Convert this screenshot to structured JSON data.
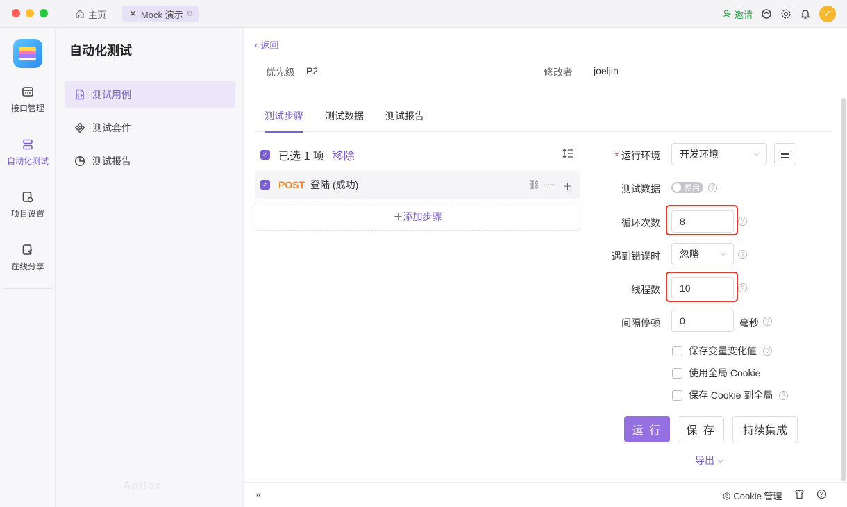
{
  "titlebar": {
    "home_label": "主页",
    "tab_label": "Mock 演示",
    "invite_label": "邀请"
  },
  "rail": {
    "items": [
      {
        "label": "接口管理"
      },
      {
        "label": "自动化测试"
      },
      {
        "label": "项目设置"
      },
      {
        "label": "在线分享"
      }
    ]
  },
  "sidebar": {
    "title": "自动化测试",
    "items": [
      {
        "label": "测试用例"
      },
      {
        "label": "测试套件"
      },
      {
        "label": "测试报告"
      }
    ],
    "watermark": "Apifox"
  },
  "main": {
    "back_label": "返回",
    "priority_label": "优先级",
    "priority_value": "P2",
    "modifier_label": "修改者",
    "modifier_value": "joeljin",
    "tabs": [
      {
        "label": "测试步骤"
      },
      {
        "label": "测试数据"
      },
      {
        "label": "测试报告"
      }
    ],
    "selected_text": "已选 1 项",
    "remove_label": "移除",
    "step": {
      "method": "POST",
      "name": "登陆 (成功)"
    },
    "add_step_label": "＋添加步骤"
  },
  "form": {
    "env_label": "运行环境",
    "env_value": "开发环境",
    "test_data_label": "测试数据",
    "toggle_text": "停用",
    "loop_label": "循环次数",
    "loop_value": "8",
    "on_error_label": "遇到错误时",
    "on_error_value": "忽略",
    "threads_label": "线程数",
    "threads_value": "10",
    "interval_label": "间隔停顿",
    "interval_value": "0",
    "interval_unit": "毫秒",
    "checkboxes": [
      {
        "label": "保存变量变化值",
        "checked": false
      },
      {
        "label": "使用全局 Cookie",
        "checked": false
      },
      {
        "label": "保存 Cookie 到全局",
        "checked": false
      }
    ],
    "run_label": "运 行",
    "save_label": "保 存",
    "ci_label": "持续集成",
    "export_label": "导出"
  },
  "footer": {
    "cookie_label": "Cookie 管理"
  },
  "colors": {
    "accent": "#7b5fd6",
    "primary_button": "#9470e0",
    "post_method": "#ee8a2a",
    "highlight": "#e23b2b"
  }
}
